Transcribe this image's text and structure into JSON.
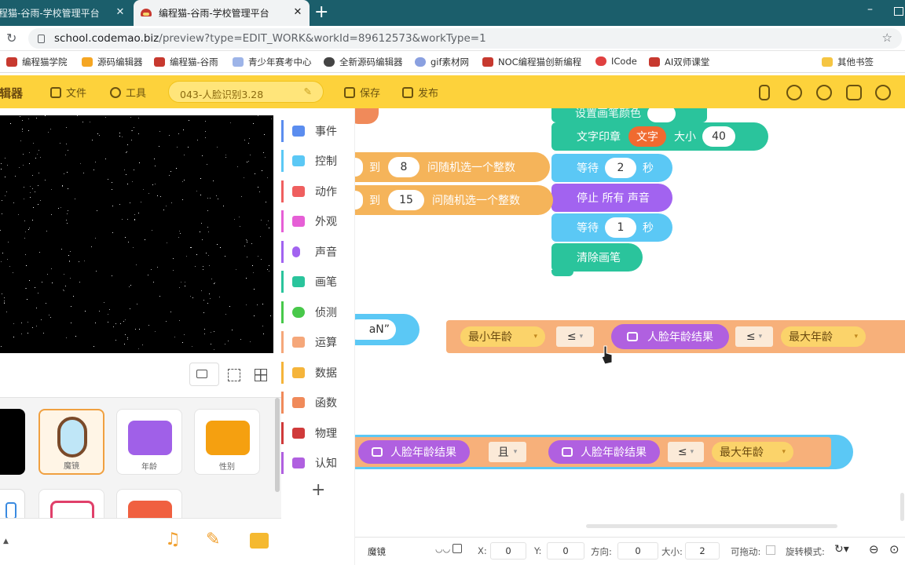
{
  "browser": {
    "tabs": [
      {
        "title": "编程猫-谷雨-学校管理平台"
      },
      {
        "title": "编程猫-谷雨-学校管理平台"
      }
    ],
    "new_tab": "+",
    "close": "✕",
    "url_host": "school.codemao.biz",
    "url_rest": "/preview?type=EDIT_WORK&workId=89612573&workType=1",
    "bookmarks": [
      "编程猫学院",
      "源码编辑器",
      "编程猫-谷雨",
      "青少年赛考中心",
      "全新源码编辑器",
      "gif素材网",
      "NOC编程猫创新编程",
      "ICode",
      "AI双师课堂"
    ],
    "other_bookmarks": "其他书签"
  },
  "toolbar": {
    "logo": "编辑器",
    "file": "文件",
    "tools": "工具",
    "project_name": "043-人脸识别3.28",
    "save": "保存",
    "publish": "发布"
  },
  "sprites": [
    {
      "name": "魔镜"
    },
    {
      "name": "年龄"
    },
    {
      "name": "性别"
    }
  ],
  "categories": [
    {
      "label": "事件",
      "color": "#5b8def"
    },
    {
      "label": "控制",
      "color": "#5bc8f5"
    },
    {
      "label": "动作",
      "color": "#ef5f5f"
    },
    {
      "label": "外观",
      "color": "#e65fd6"
    },
    {
      "label": "声音",
      "color": "#a263f0"
    },
    {
      "label": "画笔",
      "color": "#2ac49c"
    },
    {
      "label": "侦测",
      "color": "#48c84a"
    },
    {
      "label": "运算",
      "color": "#f5a77a"
    },
    {
      "label": "数据",
      "color": "#f5b43a"
    },
    {
      "label": "函数",
      "color": "#f08a5a"
    },
    {
      "label": "物理",
      "color": "#d03a3a"
    },
    {
      "label": "认知",
      "color": "#b060e0"
    }
  ],
  "add_category": "+",
  "blocks": {
    "text_stamp": "文字印章",
    "text": "文字",
    "size": "大小",
    "size_val": "40",
    "wait1": "等待",
    "wait1_val": "2",
    "sec": "秒",
    "stop_sound": "停止 所有 声音",
    "wait2": "等待",
    "wait2_val": "1",
    "clear_pen": "清除画笔",
    "set_pen_cut": "设置画笔颜色",
    "rand1_to": "到",
    "rand1_val": "8",
    "rand1_text": "问随机选一个整数",
    "rand2_to": "到",
    "rand2_val": "15",
    "rand2_text": "问随机选一个整数",
    "str_cut": "aN”",
    "min_age": "最小年龄",
    "le": "≤",
    "face_age": "人脸年龄结果",
    "max_age": "最大年龄",
    "and": "且"
  },
  "status": {
    "sprite": "魔镜",
    "x_label": "X:",
    "x_val": "0",
    "y_label": "Y:",
    "y_val": "0",
    "dir_label": "方向:",
    "dir_val": "0",
    "size_label": "大小:",
    "size_val": "2",
    "drag_label": "可拖动:",
    "rot_label": "旋转模式:"
  }
}
